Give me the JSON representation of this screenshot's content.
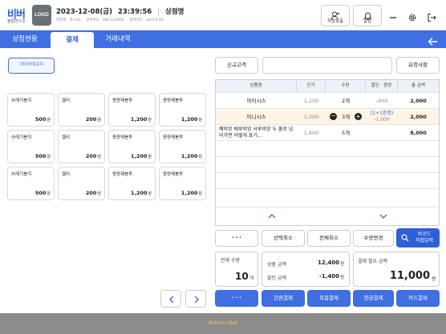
{
  "header": {
    "logo_text": "비버",
    "logo_sub": "블랍연구소",
    "logo_box": "LOGO",
    "date": "2023-12-08(금)",
    "time": "23:39:56",
    "store": "상점명",
    "meta": [
      "전번명 : 포스01",
      "장비번호 : ABC123456",
      "장비버전 : ver0.0.00"
    ],
    "call_staff": "직원호출",
    "alarm": "알림"
  },
  "tabs": [
    "상점현황",
    "결제",
    "거래내역"
  ],
  "active_tab": 1,
  "category_button": "기타카테고리",
  "products": [
    {
      "name": "쓰레기봉지",
      "price": "500",
      "unit": "원"
    },
    {
      "name": "젤리",
      "price": "200",
      "unit": "원"
    },
    {
      "name": "종량제봉투",
      "price": "1,200",
      "unit": "원"
    },
    {
      "name": "종량제봉투",
      "price": "1,200",
      "unit": "원"
    },
    {
      "name": "쓰레기봉지",
      "price": "500",
      "unit": "원"
    },
    {
      "name": "젤리",
      "price": "200",
      "unit": "원"
    },
    {
      "name": "종량제봉투",
      "price": "1,200",
      "unit": "원"
    },
    {
      "name": "종량제봉투",
      "price": "1,200",
      "unit": "원"
    },
    {
      "name": "쓰레기봉지",
      "price": "500",
      "unit": "원"
    },
    {
      "name": "젤리",
      "price": "200",
      "unit": "원"
    },
    {
      "name": "종량제봉투",
      "price": "1,200",
      "unit": "원"
    },
    {
      "name": "종량제봉투",
      "price": "1,200",
      "unit": "원"
    }
  ],
  "customer": {
    "new_label": "신규고객",
    "input_value": "",
    "request_label": "요청사항"
  },
  "grid": {
    "headers": [
      "상품명",
      "단가",
      "수량",
      "할인 · 증정",
      "총 금액"
    ],
    "rows": [
      {
        "name": "아이시스",
        "unit_price": "1,200",
        "qty": "2개",
        "discount": "-400",
        "discount2": "",
        "total": "2,000"
      },
      {
        "name": "이니시스",
        "unit_price": "1,000",
        "qty": "3개",
        "discount": "(2+1증정)",
        "discount2": "-1,000",
        "total": "2,000"
      },
      {
        "name": "예비앙 베루비앙 사루비앙 두 줄로 넘어가면 어떻게 표기...",
        "unit_price": "1,600",
        "qty": "5개",
        "discount": "",
        "discount2": "",
        "total": "8,000"
      }
    ]
  },
  "actions": {
    "more": "• • •",
    "select_cancel": "선택취소",
    "all_cancel": "전체취소",
    "qty_change": "수량변경",
    "barcode": "바코드",
    "direct_input": "직접입력"
  },
  "summary": {
    "total_qty_label": "전체 수량",
    "total_qty": "10",
    "total_qty_unit": "개",
    "product_amount_label": "상품 금액",
    "product_amount": "12,400",
    "discount_label": "할인 금액",
    "discount_amount": "-1,400",
    "won": "원",
    "payment_needed_label": "결제 필요 금액",
    "payment_needed": "11,000",
    "payment_unit": "원"
  },
  "payments": {
    "more": "• • •",
    "simple": "간편결제",
    "mixed": "복합결제",
    "cash": "현금결제",
    "card": "카드결제"
  },
  "bottom_status": "Bottom Stat",
  "colors": {
    "accent": "#3f6fe0",
    "selected_row": "#fff4e6",
    "discount_blue": "#3a66d8"
  }
}
